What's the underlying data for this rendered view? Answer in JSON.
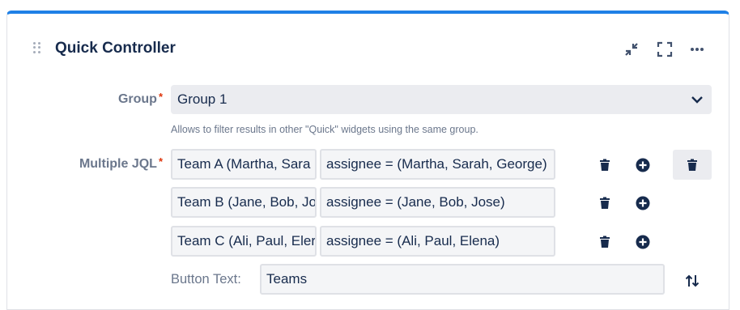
{
  "widget": {
    "title": "Quick Controller",
    "icons": [
      "drag-handle-icon",
      "minimize-icon",
      "fullscreen-icon",
      "more-icon"
    ],
    "accent_color": "#1f80e6"
  },
  "group": {
    "label": "Group",
    "required_mark": "*",
    "selected": "Group 1",
    "helper": "Allows to filter results in other \"Quick\" widgets using the same group."
  },
  "jql": {
    "label": "Multiple JQL",
    "required_mark": "*",
    "rows": [
      {
        "name": "Team A (Martha, Sara",
        "query": "assignee = (Martha, Sarah, George)"
      },
      {
        "name": "Team B (Jane, Bob, Jo",
        "query": "assignee = (Jane, Bob, Jose)"
      },
      {
        "name": "Team C (Ali, Paul, Eler",
        "query": "assignee = (Ali, Paul, Elena)"
      }
    ]
  },
  "button_text": {
    "label": "Button Text:",
    "value": "Teams"
  }
}
